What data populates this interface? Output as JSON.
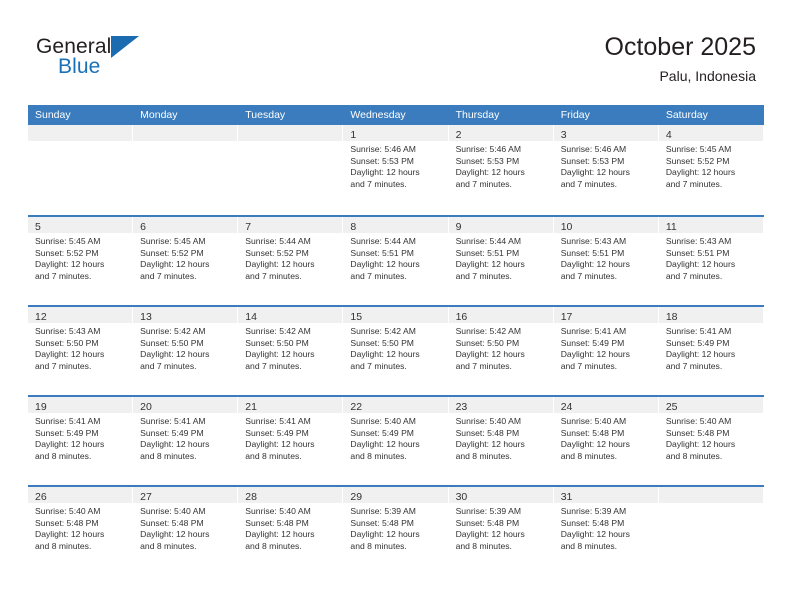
{
  "brand": {
    "name_part1": "General",
    "name_part2": "Blue",
    "flag_icon": "triangle-flag-icon",
    "accent_color": "#1a6bb0"
  },
  "header": {
    "title": "October 2025",
    "subtitle": "Palu, Indonesia"
  },
  "theme": {
    "header_row_color": "#3a7cbe",
    "date_band_color": "#f0f0f0",
    "text_color": "#333333"
  },
  "weekday_headers": [
    "Sunday",
    "Monday",
    "Tuesday",
    "Wednesday",
    "Thursday",
    "Friday",
    "Saturday"
  ],
  "labels": {
    "sunrise": "Sunrise:",
    "sunset": "Sunset:",
    "daylight": "Daylight:"
  },
  "weeks": [
    [
      {
        "empty": true
      },
      {
        "empty": true
      },
      {
        "empty": true
      },
      {
        "day": "1",
        "sunrise": "Sunrise: 5:46 AM",
        "sunset": "Sunset: 5:53 PM",
        "daylight1": "Daylight: 12 hours",
        "daylight2": "and 7 minutes."
      },
      {
        "day": "2",
        "sunrise": "Sunrise: 5:46 AM",
        "sunset": "Sunset: 5:53 PM",
        "daylight1": "Daylight: 12 hours",
        "daylight2": "and 7 minutes."
      },
      {
        "day": "3",
        "sunrise": "Sunrise: 5:46 AM",
        "sunset": "Sunset: 5:53 PM",
        "daylight1": "Daylight: 12 hours",
        "daylight2": "and 7 minutes."
      },
      {
        "day": "4",
        "sunrise": "Sunrise: 5:45 AM",
        "sunset": "Sunset: 5:52 PM",
        "daylight1": "Daylight: 12 hours",
        "daylight2": "and 7 minutes."
      }
    ],
    [
      {
        "day": "5",
        "sunrise": "Sunrise: 5:45 AM",
        "sunset": "Sunset: 5:52 PM",
        "daylight1": "Daylight: 12 hours",
        "daylight2": "and 7 minutes."
      },
      {
        "day": "6",
        "sunrise": "Sunrise: 5:45 AM",
        "sunset": "Sunset: 5:52 PM",
        "daylight1": "Daylight: 12 hours",
        "daylight2": "and 7 minutes."
      },
      {
        "day": "7",
        "sunrise": "Sunrise: 5:44 AM",
        "sunset": "Sunset: 5:52 PM",
        "daylight1": "Daylight: 12 hours",
        "daylight2": "and 7 minutes."
      },
      {
        "day": "8",
        "sunrise": "Sunrise: 5:44 AM",
        "sunset": "Sunset: 5:51 PM",
        "daylight1": "Daylight: 12 hours",
        "daylight2": "and 7 minutes."
      },
      {
        "day": "9",
        "sunrise": "Sunrise: 5:44 AM",
        "sunset": "Sunset: 5:51 PM",
        "daylight1": "Daylight: 12 hours",
        "daylight2": "and 7 minutes."
      },
      {
        "day": "10",
        "sunrise": "Sunrise: 5:43 AM",
        "sunset": "Sunset: 5:51 PM",
        "daylight1": "Daylight: 12 hours",
        "daylight2": "and 7 minutes."
      },
      {
        "day": "11",
        "sunrise": "Sunrise: 5:43 AM",
        "sunset": "Sunset: 5:51 PM",
        "daylight1": "Daylight: 12 hours",
        "daylight2": "and 7 minutes."
      }
    ],
    [
      {
        "day": "12",
        "sunrise": "Sunrise: 5:43 AM",
        "sunset": "Sunset: 5:50 PM",
        "daylight1": "Daylight: 12 hours",
        "daylight2": "and 7 minutes."
      },
      {
        "day": "13",
        "sunrise": "Sunrise: 5:42 AM",
        "sunset": "Sunset: 5:50 PM",
        "daylight1": "Daylight: 12 hours",
        "daylight2": "and 7 minutes."
      },
      {
        "day": "14",
        "sunrise": "Sunrise: 5:42 AM",
        "sunset": "Sunset: 5:50 PM",
        "daylight1": "Daylight: 12 hours",
        "daylight2": "and 7 minutes."
      },
      {
        "day": "15",
        "sunrise": "Sunrise: 5:42 AM",
        "sunset": "Sunset: 5:50 PM",
        "daylight1": "Daylight: 12 hours",
        "daylight2": "and 7 minutes."
      },
      {
        "day": "16",
        "sunrise": "Sunrise: 5:42 AM",
        "sunset": "Sunset: 5:50 PM",
        "daylight1": "Daylight: 12 hours",
        "daylight2": "and 7 minutes."
      },
      {
        "day": "17",
        "sunrise": "Sunrise: 5:41 AM",
        "sunset": "Sunset: 5:49 PM",
        "daylight1": "Daylight: 12 hours",
        "daylight2": "and 7 minutes."
      },
      {
        "day": "18",
        "sunrise": "Sunrise: 5:41 AM",
        "sunset": "Sunset: 5:49 PM",
        "daylight1": "Daylight: 12 hours",
        "daylight2": "and 7 minutes."
      }
    ],
    [
      {
        "day": "19",
        "sunrise": "Sunrise: 5:41 AM",
        "sunset": "Sunset: 5:49 PM",
        "daylight1": "Daylight: 12 hours",
        "daylight2": "and 8 minutes."
      },
      {
        "day": "20",
        "sunrise": "Sunrise: 5:41 AM",
        "sunset": "Sunset: 5:49 PM",
        "daylight1": "Daylight: 12 hours",
        "daylight2": "and 8 minutes."
      },
      {
        "day": "21",
        "sunrise": "Sunrise: 5:41 AM",
        "sunset": "Sunset: 5:49 PM",
        "daylight1": "Daylight: 12 hours",
        "daylight2": "and 8 minutes."
      },
      {
        "day": "22",
        "sunrise": "Sunrise: 5:40 AM",
        "sunset": "Sunset: 5:49 PM",
        "daylight1": "Daylight: 12 hours",
        "daylight2": "and 8 minutes."
      },
      {
        "day": "23",
        "sunrise": "Sunrise: 5:40 AM",
        "sunset": "Sunset: 5:48 PM",
        "daylight1": "Daylight: 12 hours",
        "daylight2": "and 8 minutes."
      },
      {
        "day": "24",
        "sunrise": "Sunrise: 5:40 AM",
        "sunset": "Sunset: 5:48 PM",
        "daylight1": "Daylight: 12 hours",
        "daylight2": "and 8 minutes."
      },
      {
        "day": "25",
        "sunrise": "Sunrise: 5:40 AM",
        "sunset": "Sunset: 5:48 PM",
        "daylight1": "Daylight: 12 hours",
        "daylight2": "and 8 minutes."
      }
    ],
    [
      {
        "day": "26",
        "sunrise": "Sunrise: 5:40 AM",
        "sunset": "Sunset: 5:48 PM",
        "daylight1": "Daylight: 12 hours",
        "daylight2": "and 8 minutes."
      },
      {
        "day": "27",
        "sunrise": "Sunrise: 5:40 AM",
        "sunset": "Sunset: 5:48 PM",
        "daylight1": "Daylight: 12 hours",
        "daylight2": "and 8 minutes."
      },
      {
        "day": "28",
        "sunrise": "Sunrise: 5:40 AM",
        "sunset": "Sunset: 5:48 PM",
        "daylight1": "Daylight: 12 hours",
        "daylight2": "and 8 minutes."
      },
      {
        "day": "29",
        "sunrise": "Sunrise: 5:39 AM",
        "sunset": "Sunset: 5:48 PM",
        "daylight1": "Daylight: 12 hours",
        "daylight2": "and 8 minutes."
      },
      {
        "day": "30",
        "sunrise": "Sunrise: 5:39 AM",
        "sunset": "Sunset: 5:48 PM",
        "daylight1": "Daylight: 12 hours",
        "daylight2": "and 8 minutes."
      },
      {
        "day": "31",
        "sunrise": "Sunrise: 5:39 AM",
        "sunset": "Sunset: 5:48 PM",
        "daylight1": "Daylight: 12 hours",
        "daylight2": "and 8 minutes."
      },
      {
        "empty": true
      }
    ]
  ]
}
